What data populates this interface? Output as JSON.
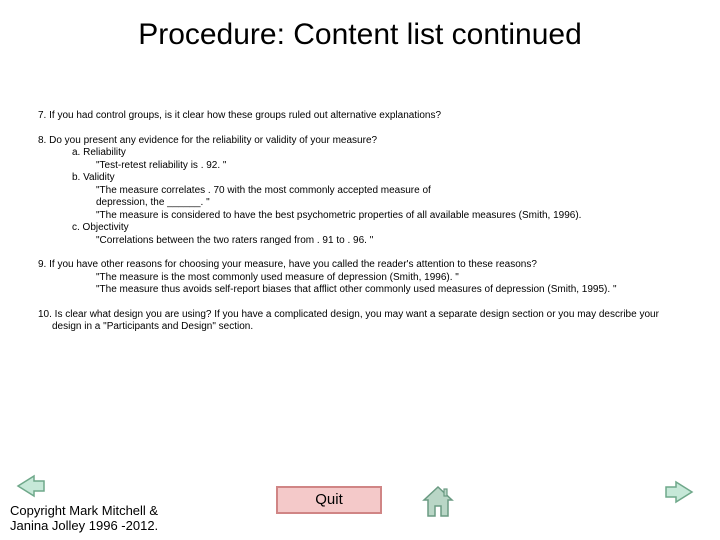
{
  "title": "Procedure: Content list continued",
  "items": {
    "q7": "7. If you had control groups,  is it clear how these groups ruled out alternative explanations?",
    "q8": {
      "head": "8. Do you present any evidence for the reliability or validity of your measure?",
      "a": "a. Reliability",
      "a1": "\"Test-retest reliability is . 92. \"",
      "b": "b. Validity",
      "b1": "\"The measure correlates . 70 with the most commonly accepted measure of",
      "b2": "depression, the ______. \"",
      "b3": "\"The measure is considered to have the best psychometric properties of all available measures (Smith, 1996).",
      "c": "c.  Objectivity",
      "c1": "\"Correlations between the two raters ranged from . 91 to . 96. \""
    },
    "q9": {
      "head": "9. If you have other reasons for choosing your measure, have you called the reader's attention to these reasons?",
      "l1": "\"The measure is the most commonly used measure of depression (Smith, 1996). \"",
      "l2": "\"The measure thus avoids self-report biases that afflict other  commonly used measures of depression (Smith, 1995). \""
    },
    "q10": "10. Is clear what design you are using? If you have a complicated design, you may want a separate design section or you may describe your design in a \"Participants and Design\" section."
  },
  "footer": {
    "copyright1": "Copyright Mark Mitchell &",
    "copyright2": "Janina Jolley 1996 -2012.",
    "quit": "Quit"
  }
}
